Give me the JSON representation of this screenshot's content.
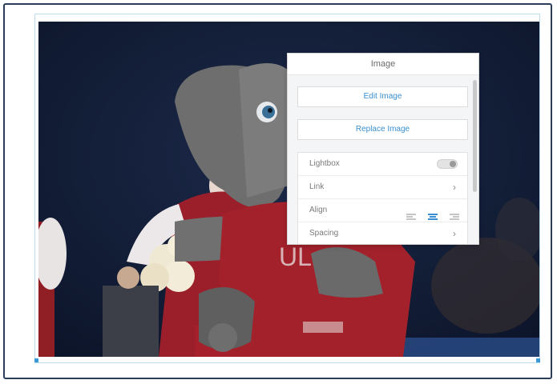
{
  "panel": {
    "title": "Image",
    "edit_button": "Edit Image",
    "replace_button": "Replace Image",
    "options": [
      {
        "label": "Lightbox",
        "control": "toggle",
        "state": "off"
      },
      {
        "label": "Link",
        "control": "chevron-right-icon"
      },
      {
        "label": "Align",
        "control": "alignment-icons",
        "selected": "center"
      },
      {
        "label": "Spacing",
        "control": "chevron-right-icon"
      }
    ]
  },
  "photo": {
    "subject": "mascot-photo",
    "icon": "image-content"
  },
  "colors": {
    "accent": "#3a8fd0",
    "frame": "#2b3d59",
    "selection_border": "#b9dcf0",
    "handle": "#3b99d4"
  }
}
